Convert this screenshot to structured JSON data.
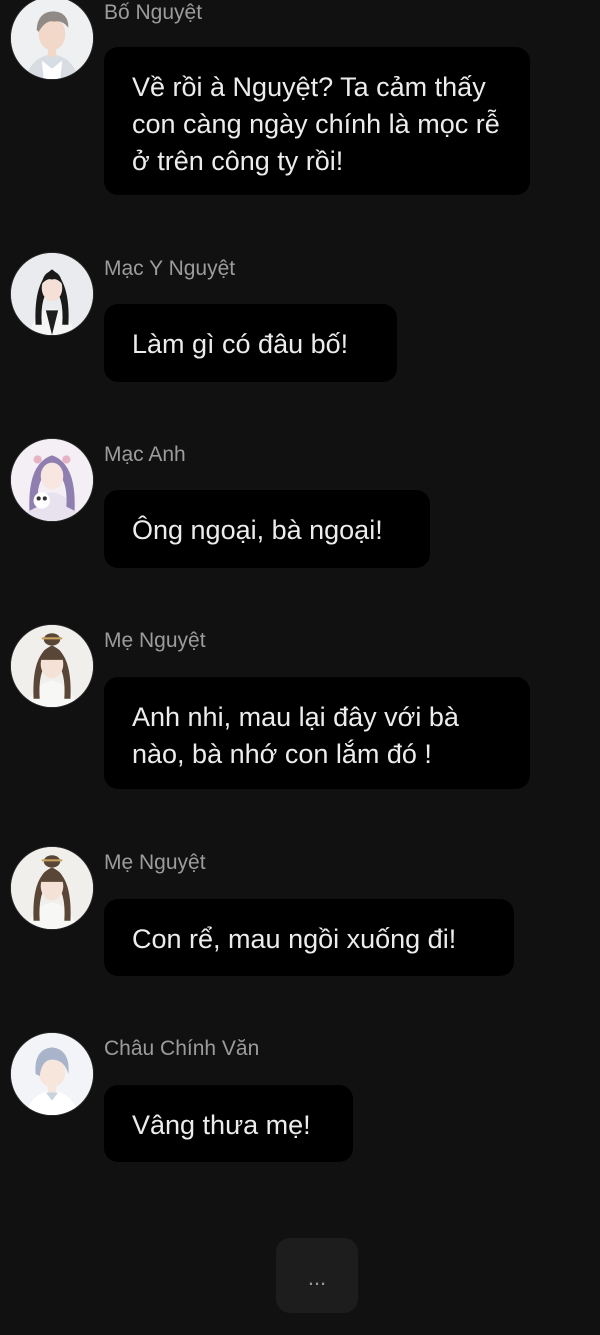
{
  "messages": [
    {
      "name": "Bố Nguyệt",
      "text": "Về rồi à Nguyệt? Ta cảm thấy con càng ngày chính là mọc rễ ở trên công ty rồi!",
      "avatar": "man-gray-hair-avatar"
    },
    {
      "name": "Mạc Y Nguyệt",
      "text": "Làm gì có đâu bố!",
      "avatar": "woman-long-black-hair-avatar"
    },
    {
      "name": "Mạc Anh",
      "text": "Ông ngoại, bà ngoại!",
      "avatar": "girl-purple-hair-avatar"
    },
    {
      "name": "Mẹ Nguyệt",
      "text": "Anh nhi, mau lại đây với bà nào, bà nhớ con lắm đó !",
      "avatar": "woman-hair-bun-avatar"
    },
    {
      "name": "Mẹ Nguyệt",
      "text": "Con rể, mau ngồi xuống đi!",
      "avatar": "woman-hair-bun-avatar"
    },
    {
      "name": "Châu Chính Văn",
      "text": "Vâng thưa mẹ!",
      "avatar": "man-silver-hair-avatar"
    }
  ],
  "typing_indicator": "..."
}
